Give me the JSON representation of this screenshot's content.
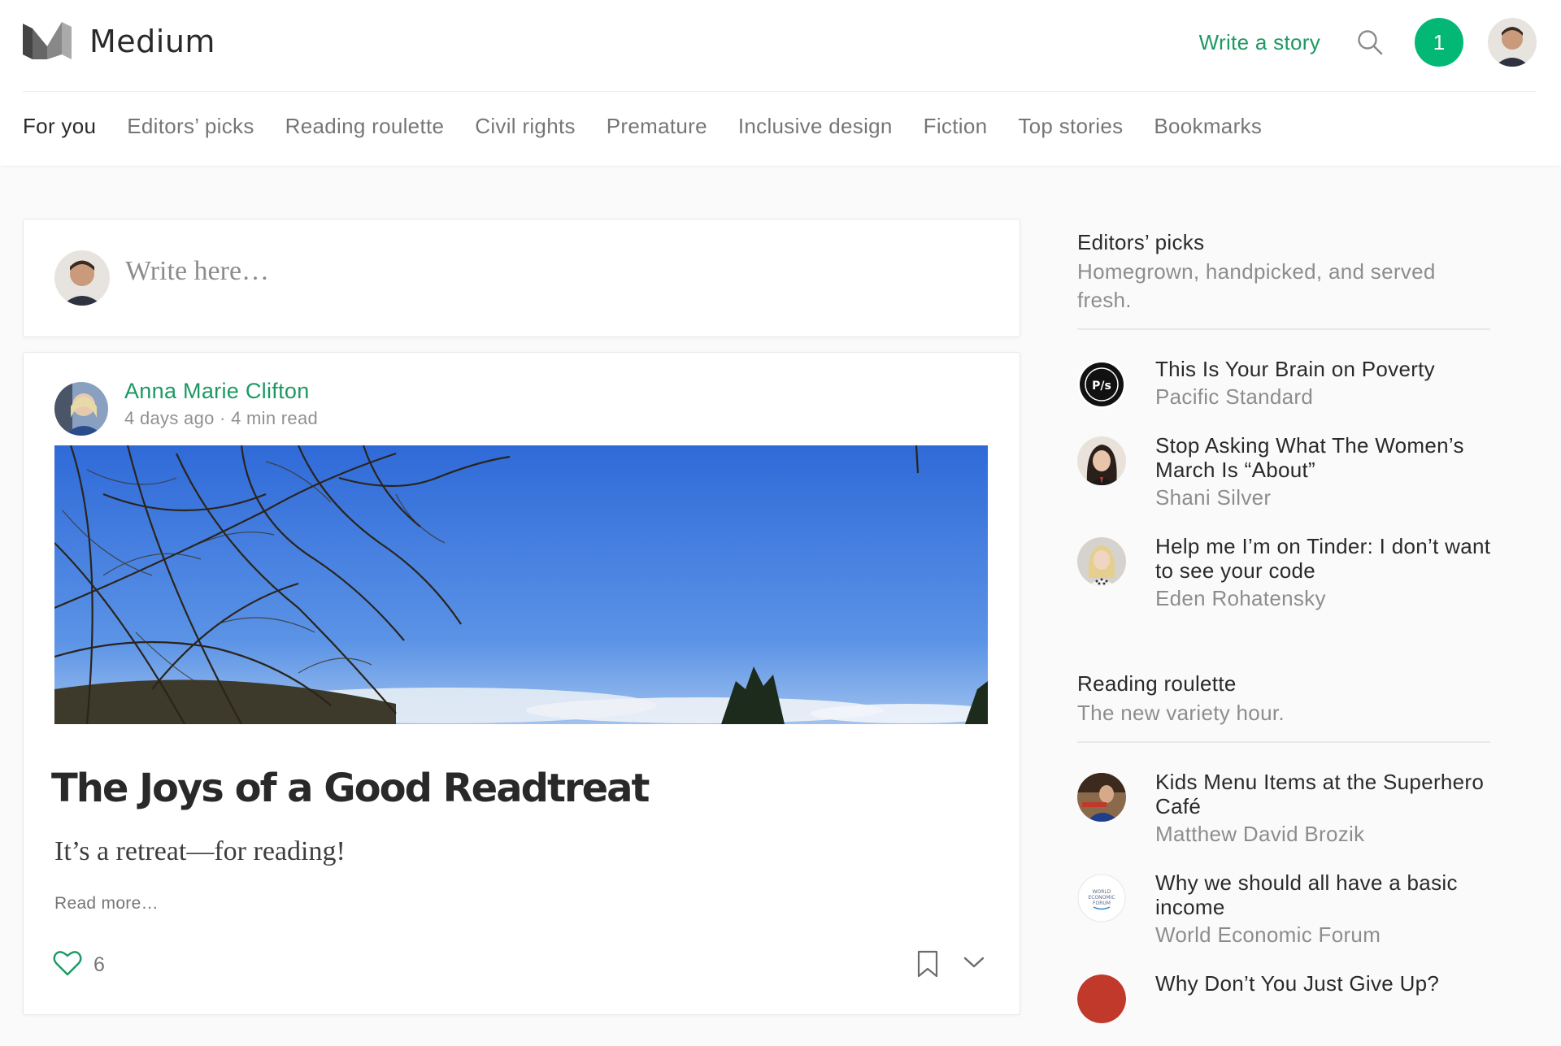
{
  "header": {
    "logo_text": "Medium",
    "write_story": "Write a story",
    "notification_count": "1",
    "accent_color": "#1c9963"
  },
  "nav": {
    "items": [
      "For you",
      "Editors’ picks",
      "Reading roulette",
      "Civil rights",
      "Premature",
      "Inclusive design",
      "Fiction",
      "Top stories",
      "Bookmarks"
    ]
  },
  "compose": {
    "placeholder": "Write here…"
  },
  "post": {
    "author": "Anna Marie Clifton",
    "meta": "4 days ago · 4 min read",
    "title": "The Joys of a Good Readtreat",
    "subtitle": "It’s a retreat—for reading!",
    "read_more": "Read more…",
    "likes": "6"
  },
  "sidebar": {
    "editors_picks": {
      "title": "Editors’ picks",
      "subtitle": "Homegrown, handpicked, and served fresh.",
      "items": [
        {
          "title": "This Is Your Brain on Poverty",
          "author": "Pacific Standard"
        },
        {
          "title": "Stop Asking What The Women’s March Is “About”",
          "author": "Shani Silver"
        },
        {
          "title": "Help me I’m on Tinder: I don’t want to see your code",
          "author": "Eden Rohatensky"
        }
      ]
    },
    "reading_roulette": {
      "title": "Reading roulette",
      "subtitle": "The new variety hour.",
      "items": [
        {
          "title": "Kids Menu Items at the Superhero Café",
          "author": "Matthew David Brozik"
        },
        {
          "title": "Why we should all have a basic income",
          "author": "World Economic Forum"
        },
        {
          "title": "Why Don’t You Just Give Up?",
          "author": ""
        }
      ]
    }
  }
}
